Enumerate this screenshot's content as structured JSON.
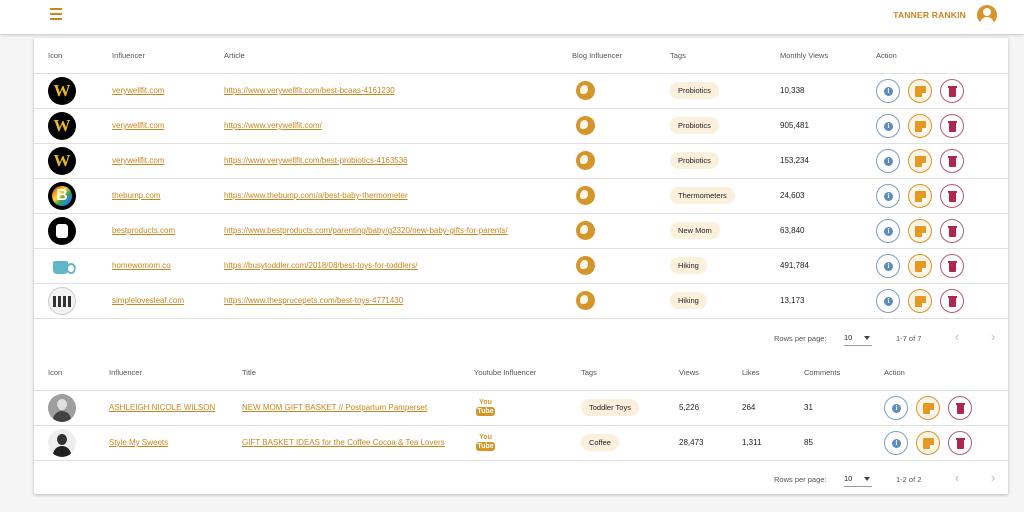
{
  "header": {
    "menu_icon": "hamburger-menu-icon",
    "user_name": "TANNER RANKIN",
    "user_icon": "account-circle-icon"
  },
  "blog_table": {
    "columns": [
      "Icon",
      "Influencer",
      "Article",
      "Blog Influencer",
      "Tags",
      "Monthly Views",
      "Action"
    ],
    "rows": [
      {
        "influencer": "verywellfit.com",
        "article": "https://www.verywellfit.com/best-bcaas-4161230",
        "tag": "Probiotics",
        "views": "10,338"
      },
      {
        "influencer": "verywellfit.com",
        "article": "https://www.verywellfit.com/",
        "tag": "Probiotics",
        "views": "905,481"
      },
      {
        "influencer": "verywellfit.com",
        "article": "https://www.verywellfit.com/best-probiotics-4163536",
        "tag": "Probiotics",
        "views": "153,234"
      },
      {
        "influencer": "thebump.com",
        "article": "https://www.thebump.com/a/best-baby-thermometer",
        "tag": "Thermometers",
        "views": "24,603"
      },
      {
        "influencer": "bestproducts.com",
        "article": "https://www.bestproducts.com/parenting/baby/g2320/new-baby-gifts-for-parents/",
        "tag": "New Mom",
        "views": "63,840"
      },
      {
        "influencer": "homewomom.co",
        "article": "https://busytoddler.com/2018/08/best-toys-for-toddlers/",
        "tag": "Hiking",
        "views": "491,784"
      },
      {
        "influencer": "simplelovesleaf.com",
        "article": "https://www.thesprucepets.com/best-toys-4771430",
        "tag": "Hiking",
        "views": "13,173"
      }
    ],
    "pagination": {
      "rows_label": "Rows per page:",
      "rows_value": "10",
      "range": "1-7 of 7"
    }
  },
  "youtube_table": {
    "columns": [
      "Icon",
      "Influencer",
      "Title",
      "Youtube Influencer",
      "Tags",
      "Views",
      "Likes",
      "Comments",
      "Action"
    ],
    "rows": [
      {
        "influencer": "ASHLEIGH NICOLE WILSON",
        "title": "NEW MOM GIFT BASKET // Postpartum Pamperset",
        "tag": "Toddler Toys",
        "views": "5,226",
        "likes": "264",
        "comments": "31"
      },
      {
        "influencer": "Style My Sweets",
        "title": "GIFT BASKET IDEAS for the Coffee Cocoa & Tea Lovers",
        "tag": "Coffee",
        "views": "28,473",
        "likes": "1,311",
        "comments": "85"
      }
    ],
    "youtube_logo": {
      "top": "You",
      "bottom": "Tube"
    },
    "pagination": {
      "rows_label": "Rows per page:",
      "rows_value": "10",
      "range": "1-2 of 2"
    }
  },
  "icons": {
    "blog": "globe-icon",
    "info": "info-icon",
    "edit": "edit-icon",
    "delete": "delete-icon",
    "prev": "chevron-left-icon",
    "next": "chevron-right-icon"
  },
  "colors": {
    "accent": "#c8861f",
    "chip": "#fbf0dc",
    "delete": "#b0264e",
    "info": "#5b8bc1"
  }
}
